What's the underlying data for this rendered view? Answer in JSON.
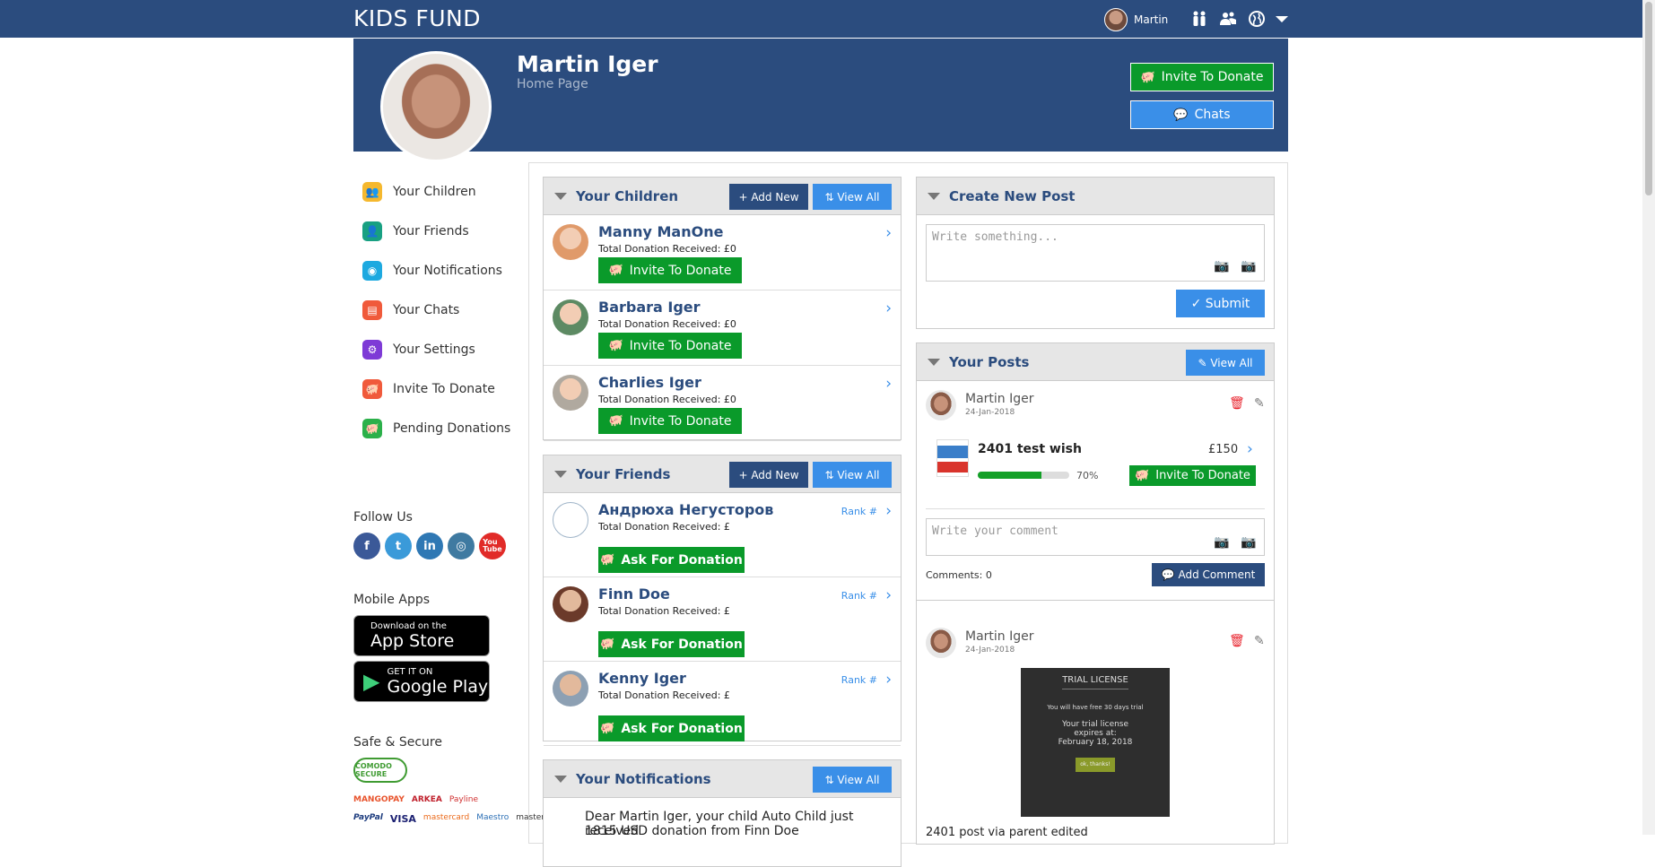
{
  "topbar": {
    "brand": "KIDS FUND",
    "user_name": "Martin",
    "icons": [
      "children-icon",
      "friends-icon",
      "globe-icon",
      "caret-down-icon"
    ]
  },
  "banner": {
    "name": "Martin Iger",
    "subtitle": "Home Page",
    "invite_label": "Invite To Donate",
    "chats_label": "Chats"
  },
  "sidebar": {
    "items": [
      {
        "label": "Your Children",
        "icon": "children-icon",
        "color": "#f5b82e"
      },
      {
        "label": "Your Friends",
        "icon": "friends-icon",
        "color": "#18a082"
      },
      {
        "label": "Your Notifications",
        "icon": "globe-icon",
        "color": "#1da9e0"
      },
      {
        "label": "Your Chats",
        "icon": "chat-icon",
        "color": "#f05a3b"
      },
      {
        "label": "Your Settings",
        "icon": "gear-icon",
        "color": "#7e3ad6"
      },
      {
        "label": "Invite To Donate",
        "icon": "piggy-bank-icon",
        "color": "#f05a3b"
      },
      {
        "label": "Pending Donations",
        "icon": "piggy-bank-icon",
        "color": "#2bb04a"
      }
    ]
  },
  "follow": {
    "title": "Follow Us",
    "networks": [
      {
        "name": "facebook-icon",
        "glyph": "f",
        "color": "#3b5998"
      },
      {
        "name": "twitter-icon",
        "glyph": "t",
        "color": "#3a9ad9"
      },
      {
        "name": "linkedin-icon",
        "glyph": "in",
        "color": "#2f78b4"
      },
      {
        "name": "instagram-icon",
        "glyph": "◎",
        "color": "#3f7aa1"
      },
      {
        "name": "youtube-icon",
        "glyph": "You\nTube",
        "color": "#e12b28"
      }
    ]
  },
  "apps": {
    "title": "Mobile Apps",
    "appstore_small": "Download on the",
    "appstore_big": "App Store",
    "play_small": "GET IT ON",
    "play_big": "Google Play"
  },
  "safe": {
    "title": "Safe & Secure",
    "comodo": "COMODO SECURE",
    "providers_row1": [
      "MANGOPAY",
      "ARKEA",
      "Payline"
    ],
    "providers_row2": [
      "PayPal",
      "VISA",
      "mastercard",
      "Maestro",
      "masterpass"
    ]
  },
  "children": {
    "title": "Your Children",
    "add_label": "Add New",
    "view_label": "View All",
    "items": [
      {
        "name": "Manny ManOne",
        "total": "Total Donation Received: £0",
        "button": "Invite To Donate",
        "color": "#e09a6a"
      },
      {
        "name": "Barbara Iger",
        "total": "Total Donation Received: £0",
        "button": "Invite To Donate",
        "color": "#5d8a63"
      },
      {
        "name": "Charlies Iger",
        "total": "Total Donation Received: £0",
        "button": "Invite To Donate",
        "color": "#b0a99f"
      }
    ]
  },
  "friends": {
    "title": "Your Friends",
    "add_label": "Add New",
    "view_label": "View All",
    "items": [
      {
        "name": "Андрюха Негусторов",
        "total": "Total Donation Received: £",
        "rank": "Rank #",
        "button": "Ask For Donation",
        "color": "#9fb4c8"
      },
      {
        "name": "Finn Doe",
        "total": "Total Donation Received: £",
        "rank": "Rank #",
        "button": "Ask For Donation",
        "color": "#6b3a2a"
      },
      {
        "name": "Kenny Iger",
        "total": "Total Donation Received: £",
        "rank": "Rank #",
        "button": "Ask For Donation",
        "color": "#8da0b3"
      }
    ]
  },
  "notifications": {
    "title": "Your Notifications",
    "view_label": "View All",
    "first_line1": "Dear Martin Iger, your child Auto Child just received",
    "first_line2": "1815 USD donation from Finn Doe"
  },
  "create_post": {
    "title": "Create New Post",
    "placeholder": "Write something...",
    "submit_label": "Submit"
  },
  "posts": {
    "title": "Your Posts",
    "view_label": "View All",
    "items": [
      {
        "author": "Martin Iger",
        "date": "24-Jan-2018",
        "wish_title": "2401 test wish",
        "price": "£150",
        "progress_pct": 70,
        "progress_label": "70%",
        "invite_label": "Invite To Donate",
        "comment_placeholder": "Write your comment",
        "comments_count": "Comments: 0",
        "add_comment_label": "Add Comment"
      },
      {
        "author": "Martin Iger",
        "date": "24-Jan-2018",
        "image_title": "TRIAL LICENSE",
        "image_line1": "You will have free 30 days trial",
        "image_line2": "Your trial license expires at:",
        "image_line3": "February 18, 2018",
        "image_button": "ok, thanks!",
        "caption": "2401 post via parent edited"
      }
    ]
  }
}
